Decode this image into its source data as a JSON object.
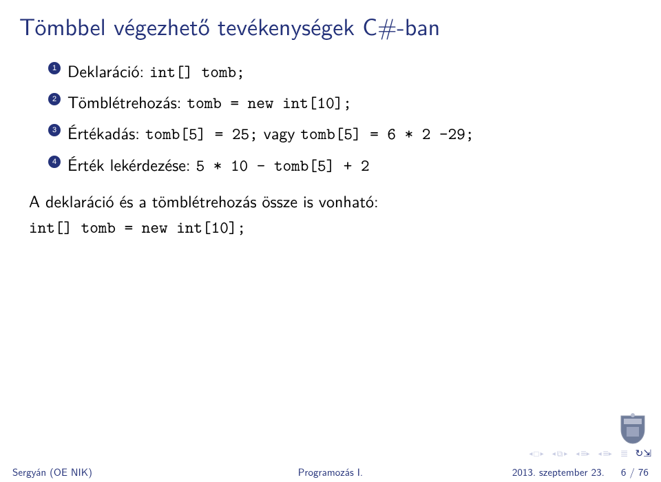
{
  "title": "Tömbbel végezhető tevékenységek C#-ban",
  "items": [
    {
      "n": "1",
      "label": "Deklaráció: ",
      "code": "int[] tomb;"
    },
    {
      "n": "2",
      "label": "Tömblétrehozás: ",
      "code": "tomb = new int[10];"
    },
    {
      "n": "3",
      "label": "Értékadás: ",
      "code": "tomb[5] = 25;",
      "mid": " vagy ",
      "code2": "tomb[5] = 6 * 2 -29;"
    },
    {
      "n": "4",
      "label": "Érték lekérdezése: ",
      "code": "5 * 10 - tomb[5] + 2"
    }
  ],
  "paragraph": {
    "text": "A deklaráció és a tömblétrehozás össze is vonható:",
    "code": "int[] tomb = new int[10];"
  },
  "footer": {
    "left": "Sergyán (OE NIK)",
    "center": "Programozás I.",
    "right_date": "2013. szeptember 23.",
    "right_page": "6 / 76"
  }
}
